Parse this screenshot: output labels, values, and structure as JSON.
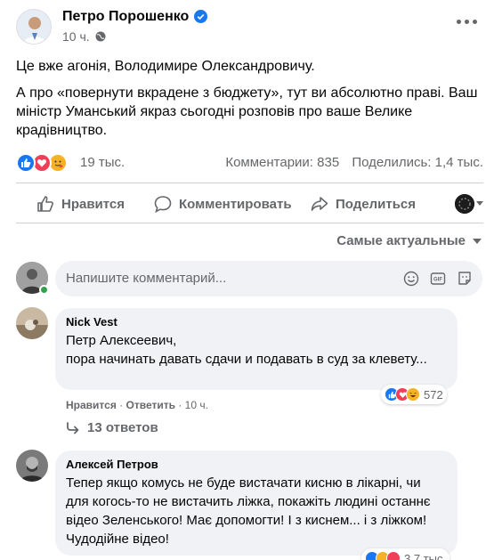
{
  "post": {
    "author": "Петро Порошенко",
    "time": "10 ч.",
    "paragraphs": [
      "Це вже агонія, Володимире Олександровичу.",
      "А про «повернути вкрадене з бюджету», тут ви абсолютно праві. Ваш міністр Уманський якраз сьогодні розповів про ваше Велике крадівництво."
    ],
    "reaction_count": "19 тыс.",
    "comments_count": "Комментарии: 835",
    "shares_count": "Поделились: 1,4 тыс."
  },
  "actions": {
    "like": "Нравится",
    "comment": "Комментировать",
    "share": "Поделиться"
  },
  "sort_label": "Самые актуальные",
  "composer": {
    "placeholder": "Напишите комментарий..."
  },
  "comments": [
    {
      "author": "Nick Vest",
      "text": "Петр Алексеевич,\nпора начинать давать сдачи и подавать в суд за клевету...",
      "like_label": "Нравится",
      "reply_label": "Ответить",
      "time": "10 ч.",
      "reaction_count": "572",
      "replies_label": "13 ответов"
    },
    {
      "author": "Алексей Петров",
      "text": "Тепер якщо комусь не буде вистачати кисню в лікарні, чи для когось-то не вистачить ліжка, покажіть людині останнє відео Зеленського! Має допомогти! І з киснем... і з ліжком! Чудодійне відео!",
      "reaction_count": "3,7 тыс."
    }
  ],
  "colors": {
    "like_blue": "#1877f2",
    "love_red": "#f33e58",
    "haha_yellow": "#f7b125",
    "secondary_text": "#65676b",
    "bubble_bg": "#f0f2f5"
  }
}
